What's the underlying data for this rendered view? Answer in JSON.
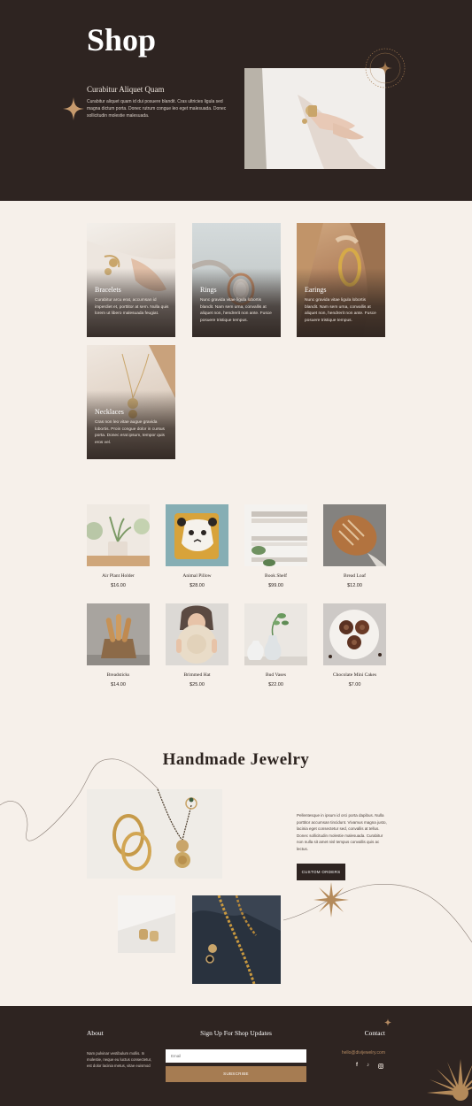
{
  "hero": {
    "title": "Shop",
    "subtitle": "Curabitur Aliquet Quam",
    "text": "Curabitur aliquet quam id dui posuere blandit. Cras ultricies ligula sed magna dictum porta. Donec rutrum congue leo eget malesuada. Donec sollicitudin molestie malesuada."
  },
  "categories": [
    {
      "name": "Bracelets",
      "desc": "Curabitur arcu erat, accumsan id imperdiet et, porttitor at sem. Nulla quis lorem ut libero malesuada feugiat."
    },
    {
      "name": "Rings",
      "desc": "Nunc gravida vitae ligula lobortis blandit. Nam sem urna, convallis at aliquet non, hendrerit non ante. Fusce posuere tristique tempus."
    },
    {
      "name": "Earings",
      "desc": "Nunc gravida vitae ligula lobortis blandit. Nam sem urna, convallis at aliquet non, hendrerit non ante. Fusce posuere tristique tempus."
    },
    {
      "name": "Necklaces",
      "desc": "Cras non leo vitae augue gravida lobortis. Proin congue dolor in cursus porta. Donec erat ipsum, tempor quis eros vel."
    }
  ],
  "products": [
    {
      "name": "Air Plant Holder",
      "price": "$16.00"
    },
    {
      "name": "Animal Pillow",
      "price": "$28.00"
    },
    {
      "name": "Book Shelf",
      "price": "$99.00"
    },
    {
      "name": "Bread Loaf",
      "price": "$12.00"
    },
    {
      "name": "Breadsticks",
      "price": "$14.00"
    },
    {
      "name": "Brimmed Hat",
      "price": "$25.00"
    },
    {
      "name": "Bud Vases",
      "price": "$22.00"
    },
    {
      "name": "Chocolate Mini Cakes",
      "price": "$7.00"
    }
  ],
  "handmade": {
    "title": "Handmade Jewelry",
    "text": "Pellentesque in ipsum id orci porta dapibus. Nulla porttitor accumsan tincidunt. Vivamus magna justo, lacinia eget consectetur sed, convallis at tellus. Donec sollicitudin molestie malesuada. Curabitur non nulla sit amet nisl tempus convallis quis ac lectus.",
    "button": "CUSTOM ORDERS"
  },
  "footer": {
    "about_heading": "About",
    "about_text": "Nam pulvinar vestibulum mollis. In molestie, neque eu luctus consectetur, est dolor lacinia metus, vitae euismod",
    "signup_heading": "Sign Up For Shop Updates",
    "email_placeholder": "Email",
    "subscribe": "SUBSCRIBE",
    "contact_heading": "Contact",
    "email": "hello@divijewelry.com"
  },
  "icons": [
    "sparkle-icon",
    "facebook-icon",
    "tiktok-icon",
    "instagram-icon"
  ],
  "colors": {
    "dark": "#2e2421",
    "cream": "#f6f0ea",
    "accent": "#a67c52"
  }
}
